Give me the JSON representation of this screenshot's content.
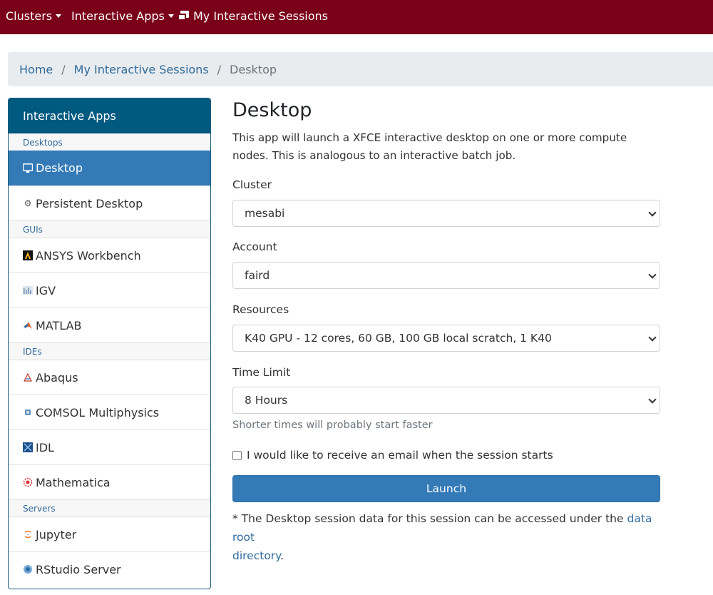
{
  "navbar": {
    "clusters_label": "Clusters",
    "interactive_apps_label": "Interactive Apps",
    "my_sessions_label": "My Interactive Sessions"
  },
  "breadcrumb": {
    "home": "Home",
    "sessions": "My Interactive Sessions",
    "current": "Desktop",
    "separator": "/"
  },
  "sidebar": {
    "header": "Interactive Apps",
    "groups": {
      "desktops": "Desktops",
      "guis": "GUIs",
      "ides": "IDEs",
      "servers": "Servers"
    },
    "items": {
      "desktop": "Desktop",
      "persistent_desktop": "Persistent Desktop",
      "ansys": "ANSYS Workbench",
      "igv": "IGV",
      "matlab": "MATLAB",
      "abaqus": "Abaqus",
      "comsol": "COMSOL Multiphysics",
      "idl": "IDL",
      "mathematica": "Mathematica",
      "jupyter": "Jupyter",
      "rstudio": "RStudio Server"
    }
  },
  "main": {
    "title": "Desktop",
    "description": "This app will launch a XFCE interactive desktop on one or more compute nodes. This is analogous to an interactive batch job.",
    "cluster_label": "Cluster",
    "cluster_value": "mesabi",
    "account_label": "Account",
    "account_value": "faird",
    "resources_label": "Resources",
    "resources_value": "K40 GPU - 12 cores, 60 GB, 100 GB local scratch, 1 K40",
    "time_label": "Time Limit",
    "time_value": "8 Hours",
    "time_help": "Shorter times will probably start faster",
    "email_checkbox_label": "I would like to receive an email when the session starts",
    "launch_label": "Launch",
    "footnote_prefix": "* The Desktop session data for this session can be accessed under the",
    "footnote_link_1": "data root",
    "footnote_link_2": "directory",
    "footnote_suffix": "."
  },
  "colors": {
    "navbar": "#7a0019",
    "sidebar_header": "#00597f",
    "active_item": "#337ab7",
    "link": "#2f6a9b"
  }
}
